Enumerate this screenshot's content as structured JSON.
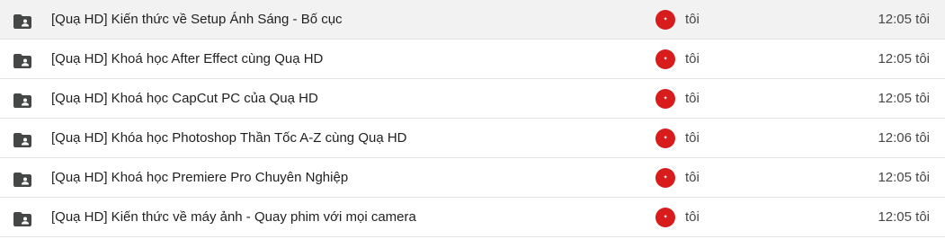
{
  "rows": [
    {
      "name": "[Quạ HD]  Kiến thức về Setup Ánh Sáng - Bố cục",
      "owner": "tôi",
      "modified": "12:05 tôi",
      "selected": true
    },
    {
      "name": "[Quạ HD] Khoá học After Effect cùng Quạ HD",
      "owner": "tôi",
      "modified": "12:05 tôi",
      "selected": false
    },
    {
      "name": "[Quạ HD] Khoá học CapCut PC của Quạ HD",
      "owner": "tôi",
      "modified": "12:05 tôi",
      "selected": false
    },
    {
      "name": "[Quạ HD] Khóa học Photoshop Thần Tốc A-Z cùng Quạ HD",
      "owner": "tôi",
      "modified": "12:06 tôi",
      "selected": false
    },
    {
      "name": "[Quạ HD] Khoá học Premiere Pro Chuyên Nghiệp",
      "owner": "tôi",
      "modified": "12:05 tôi",
      "selected": false
    },
    {
      "name": "[Quạ HD] Kiến thức về máy ảnh - Quay phim với mọi camera",
      "owner": "tôi",
      "modified": "12:05 tôi",
      "selected": false
    }
  ],
  "icons": {
    "item": "shared-folder-icon",
    "owner": "owner-avatar-icon"
  },
  "colors": {
    "folder": "#444746",
    "avatar": "#d81b1b",
    "selected_row": "#f2f2f2",
    "divider": "#e3e3e3"
  }
}
